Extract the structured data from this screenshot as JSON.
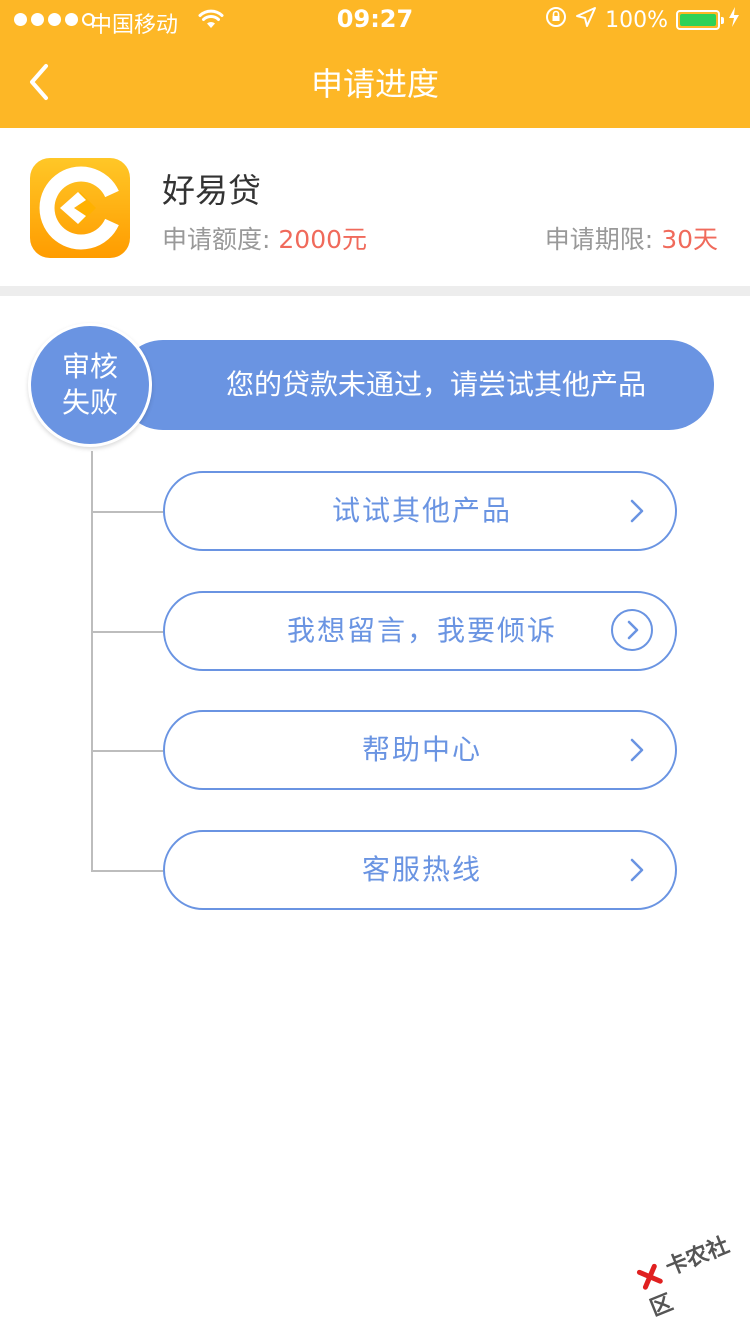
{
  "status_bar": {
    "carrier": "中国移动",
    "time": "09:27",
    "battery": "100%"
  },
  "nav": {
    "title": "申请进度"
  },
  "product": {
    "name": "好易贷",
    "amount_label": "申请额度:",
    "amount_value": "2000元",
    "term_label": "申请期限:",
    "term_value": "30天"
  },
  "result": {
    "status_line1": "审核",
    "status_line2": "失败",
    "message": "您的贷款未通过，请尝试其他产品"
  },
  "options": [
    {
      "label": "试试其他产品"
    },
    {
      "label": "我想留言，我要倾诉"
    },
    {
      "label": "帮助中心"
    },
    {
      "label": "客服热线"
    }
  ],
  "watermark": {
    "text": "卡农社区"
  },
  "colors": {
    "header": "#FDB726",
    "accent_blue": "#6A94E2",
    "highlight_red": "#F06A5B"
  }
}
